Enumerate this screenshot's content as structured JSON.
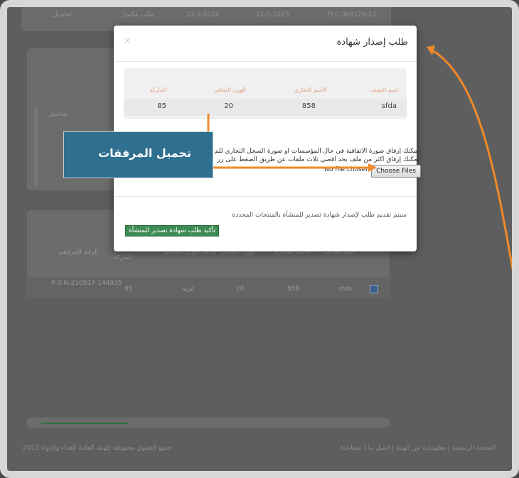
{
  "background": {
    "top_row": [
      "تفاصيل",
      "طلب مكتمل",
      "22-5-2024",
      "22-5-2023",
      "FEC 009129-23"
    ],
    "mid_rows": [
      "تفاصيل"
    ],
    "lower_headers": [
      "الرقم المرجعي",
      "الماركة",
      "وحدة الوزن الصافي",
      "الوزن الصافي",
      "الاسم التجاري",
      "اسم الصنف"
    ],
    "lower_row": {
      "ref": "P-3-N-210917-144935",
      "brand": "85",
      "unit": "لترية",
      "net": "20",
      "trade": "858",
      "item": "sfda"
    }
  },
  "modal": {
    "title": "طلب إصدار شهادة",
    "close": "×",
    "table": {
      "headers": [
        "اسم الصنف",
        "الاسم التجاري",
        "الوزن الصافي",
        "الماركة"
      ],
      "row": [
        "sfda",
        "858",
        "20",
        "85"
      ]
    },
    "note1": "يمكنك إرفاق صورة الاتفاقية في حال المؤسسات أو صورة السجل التجاري للم",
    "note2": "يمكنك إرفاق أكثر من ملف بحد أقصى ثلاث ملفات عن طريق الضغط على زر",
    "file_button": "Choose Files",
    "file_status": "No file chosen",
    "confirm_note": "سيتم تقديم طلب لإصدار شهادة تصدير للمنشأة بالمنتجات المحددة",
    "confirm_button": "تأكيد طلب شهادة تصدير للمنشأة"
  },
  "callout": {
    "label": "تحميل المرفقات"
  },
  "footer": {
    "links": "الصفحة الرئيسية | معلومات عن الهيئة | اتصل بنا | مساعدة",
    "copyright": "جميع الحقوق محفوظة للهيئة العامة للغذاء والدواء 2013"
  },
  "colors": {
    "arrow": "#f08a2b",
    "accent_button": "#3d8b54",
    "callout": "#2f6f8f"
  }
}
